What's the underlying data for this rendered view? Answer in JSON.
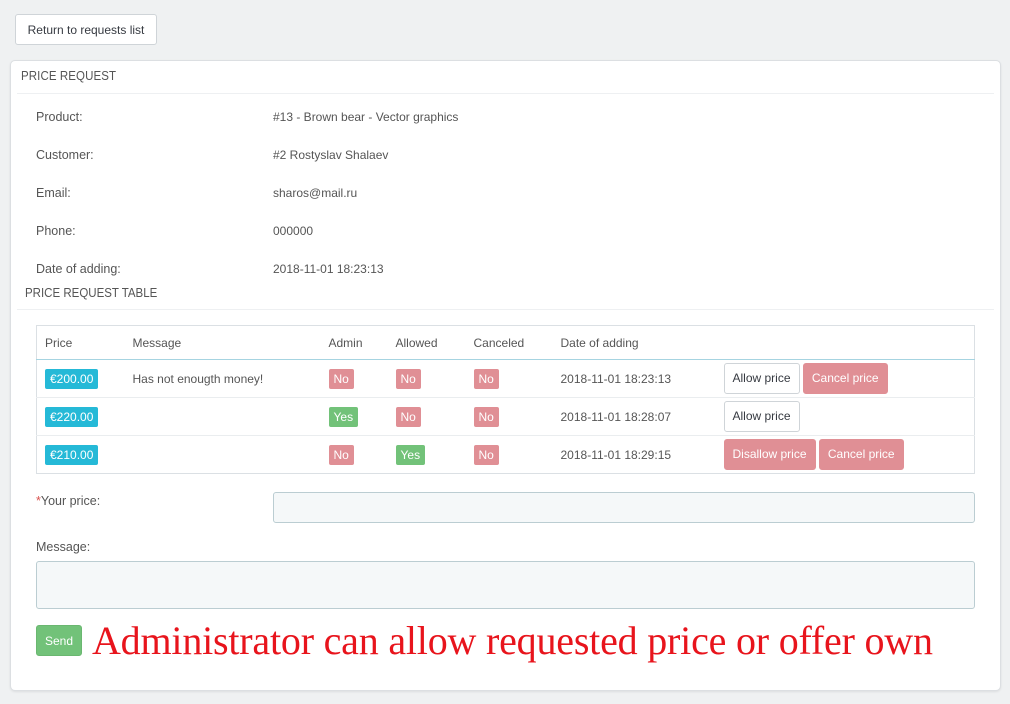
{
  "back_button": "Return to requests list",
  "panel": {
    "heading": "PRICE REQUEST",
    "info": [
      {
        "label": "Product:",
        "value": "#13 - Brown bear - Vector graphics"
      },
      {
        "label": "Customer:",
        "value": "#2 Rostyslav Shalaev"
      },
      {
        "label": "Email:",
        "value": "sharos@mail.ru"
      },
      {
        "label": "Phone:",
        "value": "000000"
      },
      {
        "label": "Date of adding:",
        "value": "2018-11-01 18:23:13"
      }
    ],
    "table_title": "PRICE REQUEST TABLE"
  },
  "table": {
    "headers": [
      "Price",
      "Message",
      "Admin",
      "Allowed",
      "Canceled",
      "Date of adding"
    ],
    "rows": [
      {
        "price": "€200.00",
        "message": "Has not enougth money!",
        "admin": "No",
        "allowed": "No",
        "canceled": "No",
        "date": "2018-11-01 18:23:13",
        "actions": [
          "Allow price",
          "Cancel price"
        ]
      },
      {
        "price": "€220.00",
        "message": "",
        "admin": "Yes",
        "allowed": "No",
        "canceled": "No",
        "date": "2018-11-01 18:28:07",
        "actions": [
          "Allow price"
        ]
      },
      {
        "price": "€210.00",
        "message": "",
        "admin": "No",
        "allowed": "Yes",
        "canceled": "No",
        "date": "2018-11-01 18:29:15",
        "actions": [
          "Disallow price",
          "Cancel price"
        ]
      }
    ]
  },
  "form": {
    "required_mark": "*",
    "price_label": "Your price:",
    "price_value": "",
    "message_label": "Message:",
    "message_value": "",
    "send_label": "Send"
  },
  "annotation": "Administrator can allow requested price or offer own",
  "colors": {
    "price_badge": "#25b9d7",
    "no_badge": "#e08f95",
    "yes_badge": "#72c279",
    "annotation": "#e8141c"
  }
}
